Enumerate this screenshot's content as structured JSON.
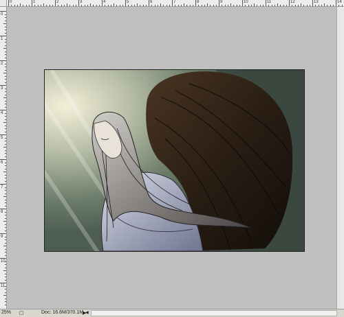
{
  "status": {
    "zoom": "25%",
    "doc_info": "Doc: 16.6M/370.1M"
  },
  "icons": {
    "status_menu": "triangle-right-icon",
    "scroll_left": "scroll-left-icon"
  },
  "ruler": {
    "top_labels": [
      "0",
      "1",
      "2",
      "3",
      "4",
      "5",
      "6",
      "7",
      "8",
      "9",
      "10",
      "11",
      "12",
      "13",
      "14"
    ],
    "left_labels": [
      "0",
      "1",
      "2",
      "3",
      "4",
      "5",
      "6",
      "7",
      "8",
      "9",
      "10",
      "11"
    ]
  },
  "artwork": {
    "description_color_bg": "#5c6b5a",
    "wing_color": "#2b2016"
  }
}
